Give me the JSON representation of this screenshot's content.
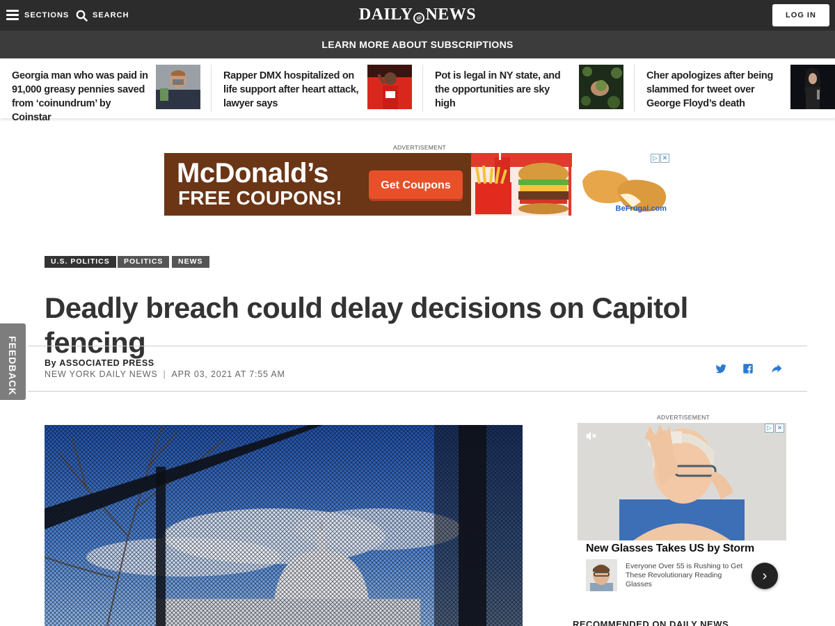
{
  "header": {
    "sections_label": "SECTIONS",
    "search_label": "SEARCH",
    "logo_left": "DAILY",
    "logo_right": "NEWS",
    "login_label": "LOG IN",
    "subscribe_banner": "LEARN MORE ABOUT SUBSCRIPTIONS"
  },
  "trending": [
    {
      "title": "Georgia man who was paid in 91,000 greasy pennies saved from ‘coinundrum’ by Coinstar"
    },
    {
      "title": "Rapper DMX hospitalized on life support after heart attack, lawyer says"
    },
    {
      "title": "Pot is legal in NY state, and the opportunities are sky high"
    },
    {
      "title": "Cher apologizes after being slammed for tweet over George Floyd’s death"
    }
  ],
  "top_ad": {
    "label": "ADVERTISEMENT",
    "line1": "McDonald’s",
    "line2": "FREE COUPONS!",
    "cta": "Get Coupons",
    "brand": "BeFrugal.com"
  },
  "article": {
    "tags": [
      "U.S. POLITICS",
      "POLITICS",
      "NEWS"
    ],
    "headline": "Deadly breach could delay decisions on Capitol fencing",
    "by_prefix": "By",
    "author": "ASSOCIATED PRESS",
    "publication": "NEW YORK DAILY NEWS",
    "meta_separator": "|",
    "timestamp": "APR 03, 2021 AT 7:55 AM"
  },
  "feedback_label": "FEEDBACK",
  "side_ad": {
    "label": "ADVERTISEMENT",
    "title": "New Glasses Takes US by Storm",
    "description": "Everyone Over 55 is Rushing to Get These Revolutionary Reading Glasses",
    "next_glyph": "›"
  },
  "recommended_heading": "RECOMMENDED ON DAILY NEWS",
  "icons": {
    "menu": "hamburger-icon",
    "search": "search-icon",
    "twitter": "twitter-icon",
    "facebook": "facebook-icon",
    "share": "share-arrow-icon",
    "mute": "mute-icon",
    "adchoices": "adchoices-icon",
    "close": "close-icon"
  },
  "colors": {
    "header_bg": "#2c2c2c",
    "subbar_bg": "#3c3c3c",
    "share_blue": "#2b7bd3",
    "tag_dark": "#333333",
    "tag_gray": "#555555"
  }
}
